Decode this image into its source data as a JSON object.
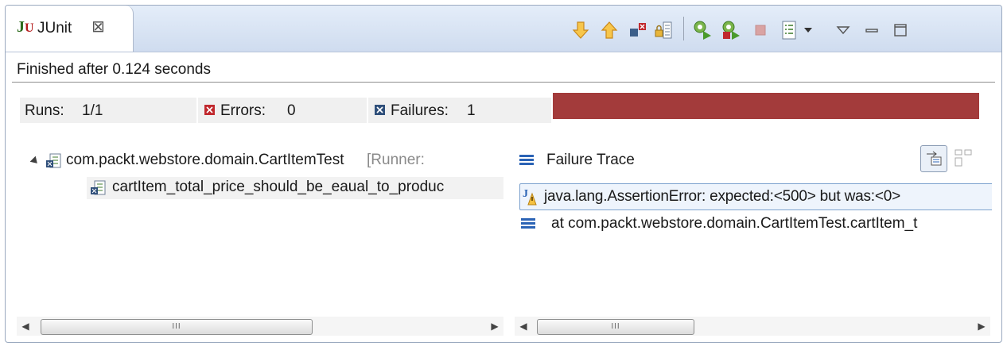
{
  "window": {
    "tab_label": "JUnit",
    "tab_icon_text": "Ju"
  },
  "status": {
    "message": "Finished after 0.124 seconds"
  },
  "counters": {
    "runs_label": "Runs:",
    "runs_value": "1/1",
    "errors_label": "Errors:",
    "errors_value": "0",
    "failures_label": "Failures:",
    "failures_value": "1"
  },
  "progress": {
    "fraction": 1.0,
    "color": "#a33b3b"
  },
  "tree": {
    "root_label": "com.packt.webstore.domain.CartItemTest",
    "root_runner": "[Runner:",
    "child_label": "cartItem_total_price_should_be_eaual_to_produc"
  },
  "trace": {
    "title": "Failure Trace",
    "lines": [
      "java.lang.AssertionError: expected:<500> but was:<0>",
      "at com.packt.webstore.domain.CartItemTest.cartItem_t"
    ]
  },
  "scroll": {
    "thumb_grip": "III"
  },
  "colors": {
    "accent": "#2b63b5",
    "error": "#c0282d"
  }
}
